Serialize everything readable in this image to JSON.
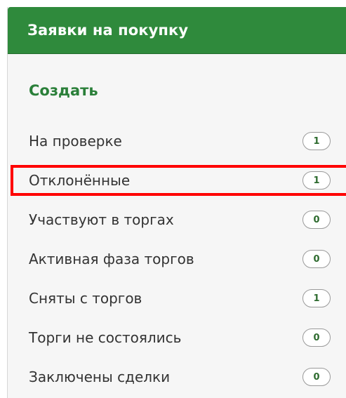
{
  "panel": {
    "title": "Заявки на покупку",
    "create_label": "Создать",
    "highlight_color": "#ff0000",
    "header_color": "#2f8a3c",
    "items": [
      {
        "label": "На проверке",
        "count": "1",
        "highlighted": false
      },
      {
        "label": "Отклонённые",
        "count": "1",
        "highlighted": true
      },
      {
        "label": "Участвуют в торгах",
        "count": "0",
        "highlighted": false
      },
      {
        "label": "Активная фаза торгов",
        "count": "0",
        "highlighted": false
      },
      {
        "label": "Сняты с торгов",
        "count": "1",
        "highlighted": false
      },
      {
        "label": "Торги не состоялись",
        "count": "0",
        "highlighted": false
      },
      {
        "label": "Заключены сделки",
        "count": "0",
        "highlighted": false
      }
    ]
  }
}
